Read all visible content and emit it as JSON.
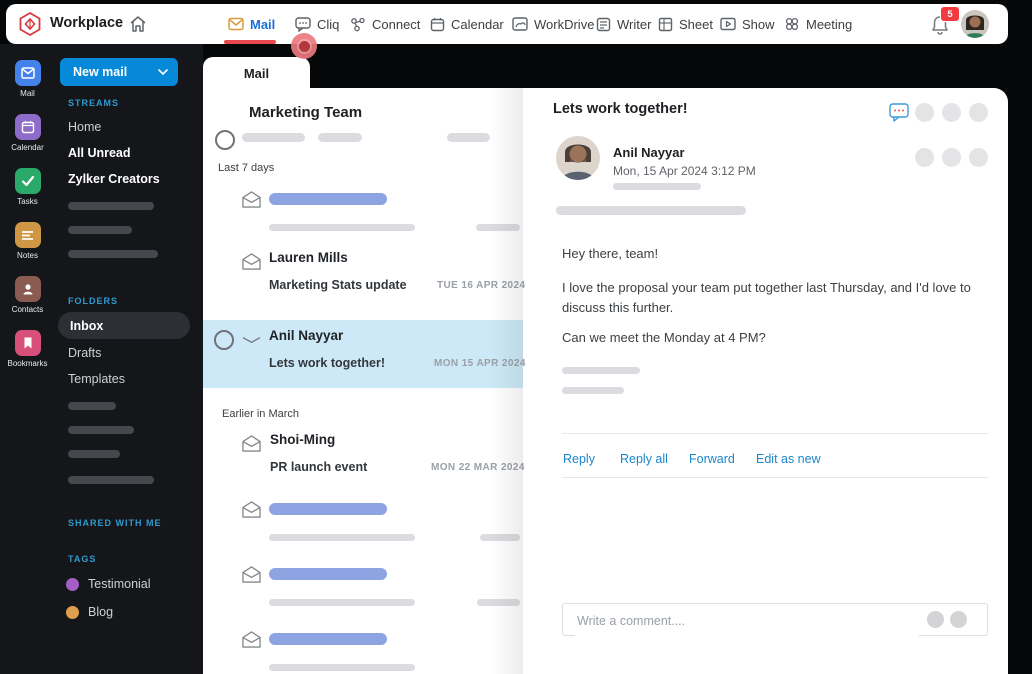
{
  "topbar": {
    "brand": "Workplace",
    "nav": [
      {
        "label": "Mail",
        "active": true
      },
      {
        "label": "Cliq"
      },
      {
        "label": "Connect"
      },
      {
        "label": "Calendar"
      },
      {
        "label": "WorkDrive"
      },
      {
        "label": "Writer"
      },
      {
        "label": "Sheet"
      },
      {
        "label": "Show"
      },
      {
        "label": "Meeting"
      }
    ],
    "notification_count": "5"
  },
  "app_rail": {
    "items": [
      {
        "label": "Mail",
        "color": "#4581ea"
      },
      {
        "label": "Calendar",
        "color": "#8f6cc9"
      },
      {
        "label": "Tasks",
        "color": "#2aa968"
      },
      {
        "label": "Notes",
        "color": "#cf9743"
      },
      {
        "label": "Contacts",
        "color": "#8a5b50"
      },
      {
        "label": "Bookmarks",
        "color": "#d8507a"
      }
    ]
  },
  "sidebar": {
    "new_mail": "New mail",
    "streams_title": "STREAMS",
    "streams": [
      "Home",
      "All Unread",
      "Zylker Creators"
    ],
    "folders_title": "FOLDERS",
    "folders": [
      "Inbox",
      "Drafts",
      "Templates"
    ],
    "selected_folder": "Inbox",
    "shared_title": "SHARED WITH ME",
    "tags_title": "TAGS",
    "tags": [
      {
        "label": "Testimonial",
        "color": "#a45fc7"
      },
      {
        "label": "Blog",
        "color": "#dd9f4e"
      }
    ]
  },
  "mail_list": {
    "tab": "Mail",
    "title": "Marketing Team",
    "sections": [
      {
        "label": "Last 7 days"
      },
      {
        "label": "Earlier in March"
      }
    ],
    "items": [
      {
        "sender": "Lauren Mills",
        "subject": "Marketing Stats update",
        "date": "TUE 16 APR 2024"
      },
      {
        "sender": "Anil Nayyar",
        "subject": "Lets work together!",
        "date": "MON 15 APR 2024",
        "selected": true
      },
      {
        "sender": "Shoi-Ming",
        "subject": "PR launch event",
        "date": "MON 22 MAR 2024"
      }
    ]
  },
  "reading_pane": {
    "subject": "Lets work together!",
    "sender": "Anil Nayyar",
    "datetime": "Mon, 15 Apr 2024 3:12 PM",
    "body": {
      "p1": "Hey there, team!",
      "p2": "I love the proposal your team put together last Thursday, and I'd love to discuss this further.",
      "p3": "Can we meet the Monday at 4 PM?"
    },
    "actions": {
      "reply": "Reply",
      "reply_all": "Reply all",
      "forward": "Forward",
      "edit_as_new": "Edit as new"
    },
    "comment_placeholder": "Write a comment...."
  },
  "colors": {
    "accent_blue": "#0689d8",
    "active_nav_underline": "#e8494f",
    "selected_item_bg": "#cde9f7",
    "link_blue": "#1b87ca",
    "placeholder_blue": "#8ea4e2",
    "sidebar_bg": "#141619"
  }
}
